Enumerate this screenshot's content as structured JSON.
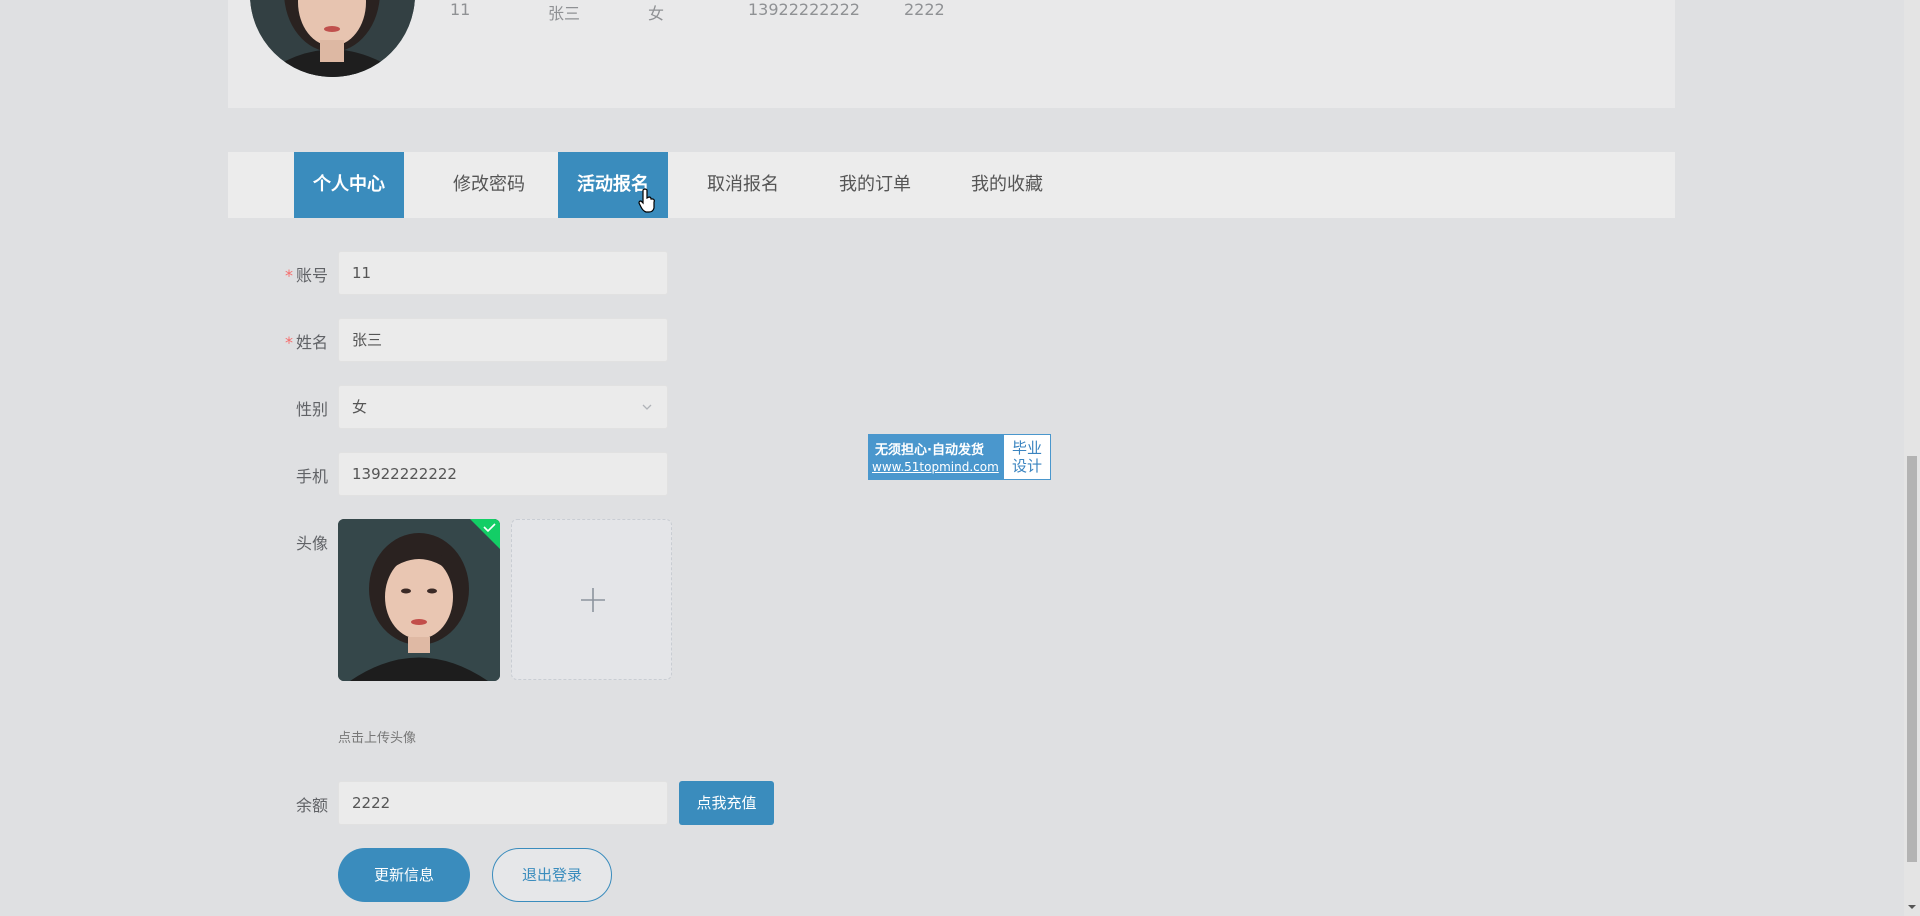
{
  "profile_summary": {
    "account": "11",
    "name": "张三",
    "gender": "女",
    "phone": "13922222222",
    "balance": "2222"
  },
  "tabs": [
    {
      "label": "个人中心",
      "active": true
    },
    {
      "label": "修改密码",
      "active": false
    },
    {
      "label": "活动报名",
      "active": true
    },
    {
      "label": "取消报名",
      "active": false
    },
    {
      "label": "我的订单",
      "active": false
    },
    {
      "label": "我的收藏",
      "active": false
    }
  ],
  "form": {
    "account_label": "账号",
    "account_value": "11",
    "name_label": "姓名",
    "name_value": "张三",
    "gender_label": "性别",
    "gender_value": "女",
    "phone_label": "手机",
    "phone_value": "13922222222",
    "avatar_label": "头像",
    "upload_hint": "点击上传头像",
    "balance_label": "余额",
    "balance_value": "2222",
    "recharge_button": "点我充值",
    "update_button": "更新信息",
    "logout_button": "退出登录",
    "required_mark": "*"
  },
  "watermark": {
    "line1": "无须担心·自动发货",
    "line2": "www.51topmind.com",
    "right_line1": "毕业",
    "right_line2": "设计"
  },
  "colors": {
    "primary": "#3a8cbd",
    "required": "#f56c6c",
    "background": "#dfe0e2"
  }
}
